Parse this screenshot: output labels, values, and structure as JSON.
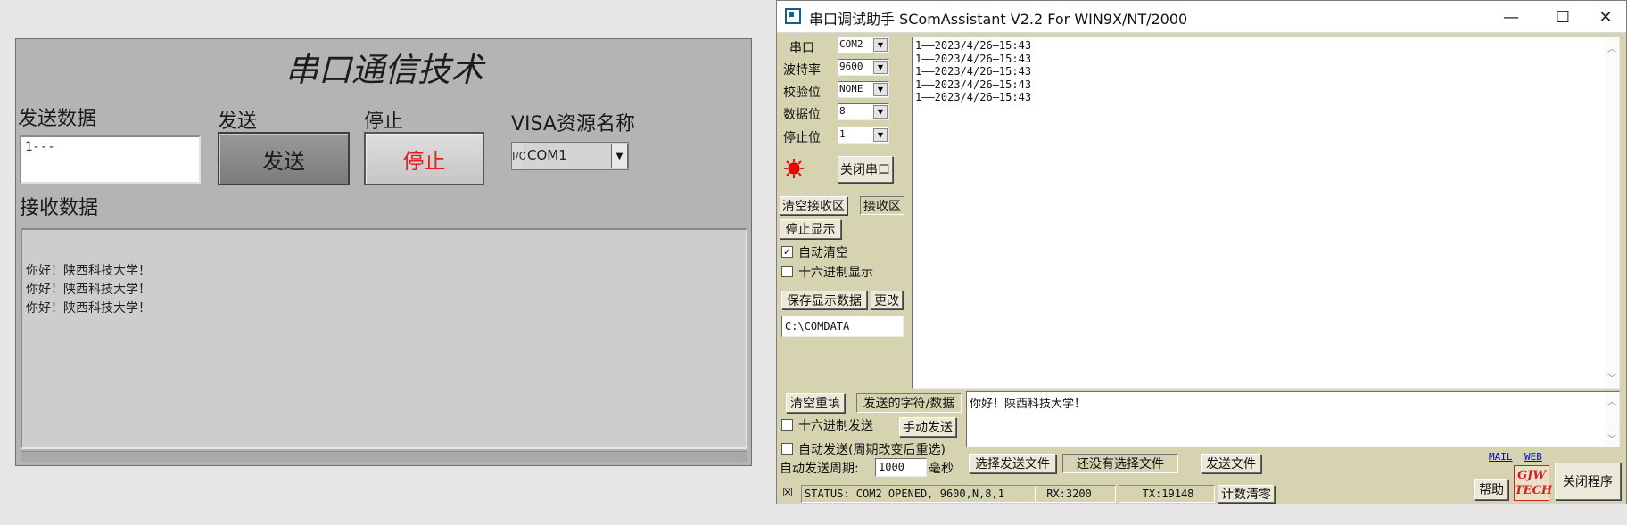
{
  "labview": {
    "title": "串口通信技术",
    "send_label": "发送数据",
    "send_value": "1---",
    "send_btn_caption": "发送",
    "send_btn_text": "发送",
    "stop_btn_caption": "停止",
    "stop_btn_text": "停止",
    "visa_label": "VISA资源名称",
    "visa_icon": "I/O",
    "visa_value": "COM1",
    "recv_label": "接收数据",
    "recv_lines": [
      "你好！陕西科技大学！",
      "你好！陕西科技大学！",
      "你好！陕西科技大学！"
    ]
  },
  "scom": {
    "title": "串口调试助手 SComAssistant V2.2 For WIN9X/NT/2000",
    "port_label": "串口",
    "port_value": "COM2",
    "baud_label": "波特率",
    "baud_value": "9600",
    "parity_label": "校验位",
    "parity_value": "NONE",
    "data_label": "数据位",
    "data_value": "8",
    "stop_label": "停止位",
    "stop_value": "1",
    "close_port_btn": "关闭串口",
    "clear_recv_btn": "清空接收区",
    "recv_area_btn": "接收区",
    "stop_display_btn": "停止显示",
    "auto_clear_label": "自动清空",
    "auto_clear_checked": "✓",
    "hex_display_label": "十六进制显示",
    "save_data_btn": "保存显示数据",
    "change_btn": "更改",
    "save_path": "C:\\COMDATA",
    "recv_lines": [
      "1——2023/4/26—15:43",
      "1——2023/4/26—15:43",
      "1——2023/4/26—15:43",
      "1——2023/4/26—15:43",
      "1——2023/4/26—15:43"
    ],
    "clear_resend_btn": "清空重填",
    "send_chars_btn": "发送的字符/数据",
    "hex_send_label": "十六进制发送",
    "manual_send_btn": "手动发送",
    "auto_send_label": "自动发送(周期改变后重选)",
    "tx_text": "你好！陕西科技大学！",
    "period_label": "自动发送周期:",
    "period_value": "1000",
    "ms_label": "毫秒",
    "choose_file_btn": "选择发送文件",
    "no_file_text": "还没有选择文件",
    "send_file_btn": "发送文件",
    "mail_link": "MAIL",
    "web_link": "WEB",
    "help_btn": "帮助",
    "logo_text": "GJW TECH",
    "exit_btn": "关闭程序",
    "status_text": "STATUS: COM2 OPENED, 9600,N,8,1",
    "rx_text": "RX:3200",
    "tx_count_text": "TX:19148",
    "reset_count_btn": "计数清零"
  }
}
